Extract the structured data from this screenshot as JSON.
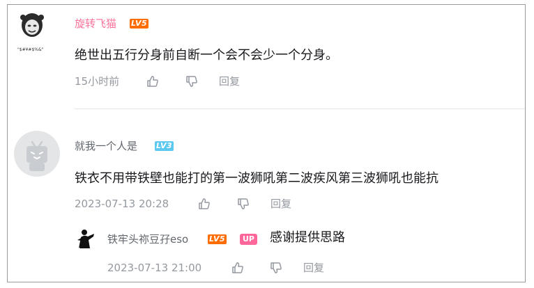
{
  "comments": [
    {
      "username": "旋转飞猫",
      "username_color": "#fb7299",
      "level": "LV5",
      "avatar_text": "\"$#¥#$%&\"",
      "content": "绝世出五行分身前自断一个会不会少一个分身。",
      "time": "15小时前",
      "reply_label": "回复"
    },
    {
      "username": "就我一个人是",
      "username_color": "#61666d",
      "level": "LV3",
      "content": "铁衣不用带铁壁也能打的第一波狮吼第二波疾风第三波狮吼也能抗",
      "time": "2023-07-13 20:28",
      "reply_label": "回复",
      "reply": {
        "username": "铁牢头祢豆孖eso",
        "level": "LV5",
        "up_badge": "UP",
        "content": "感谢提供思路",
        "time": "2023-07-13 21:00",
        "reply_label": "回复"
      }
    }
  ],
  "icons": {
    "like": "thumbs-up-icon",
    "dislike": "thumbs-down-icon"
  },
  "colors": {
    "meta": "#9499a0",
    "text": "#18191c",
    "level_orange": "#ff6c00",
    "level_blue": "#5dc8f0",
    "up_badge": "#ff6699"
  }
}
